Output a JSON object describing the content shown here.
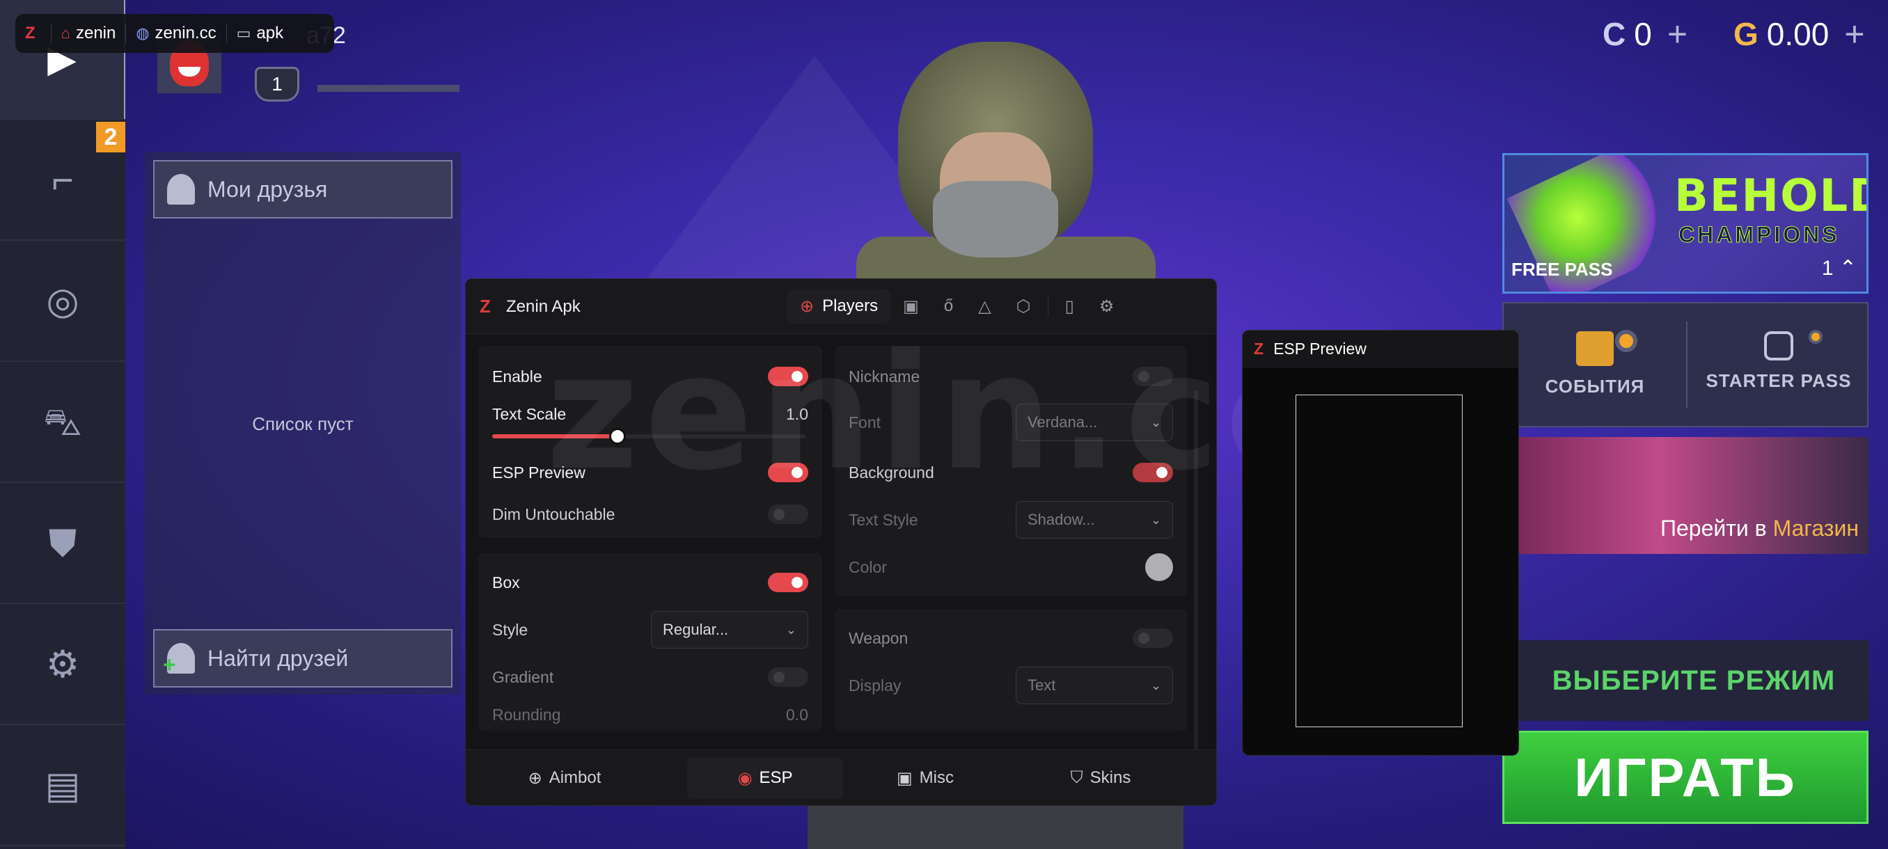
{
  "tagbar": {
    "logo": "Z",
    "tags": [
      {
        "icon": "tag-icon",
        "text": "zenin"
      },
      {
        "icon": "globe-icon",
        "text": "zenin.cc"
      },
      {
        "icon": "monitor-icon",
        "text": "apk"
      }
    ]
  },
  "player": {
    "name_fragment": "a72",
    "level": "1"
  },
  "sidebar": {
    "badge": "2"
  },
  "friends": {
    "my_friends": "Мои друзья",
    "empty": "Список пуст",
    "find_friends": "Найти друзей"
  },
  "currency": {
    "coins": "0",
    "gold": "0.00"
  },
  "promo": {
    "line1": "BEHOLDER",
    "line2": "CHAMPIONS",
    "free_pass": "FREE PASS",
    "pass_level": "1"
  },
  "events": {
    "events_label": "СОБЫТИЯ",
    "starter_pass_label": "STARTER PASS"
  },
  "shop": {
    "prefix": "Перейти в",
    "store": "Магазин"
  },
  "mode_button": "ВЫБЕРИТЕ РЕЖИМ",
  "play_button": "ИГРАТЬ",
  "menu": {
    "logo": "Z",
    "title": "Zenin Apk",
    "active_tab": "Players",
    "watermark": "zenin.cc",
    "left": {
      "enable": "Enable",
      "text_scale": "Text Scale",
      "text_scale_value": "1.0",
      "text_scale_fraction": 0.4,
      "esp_preview": "ESP Preview",
      "dim_untouchable": "Dim Untouchable",
      "box": "Box",
      "style": "Style",
      "style_value": "Regular...",
      "gradient": "Gradient",
      "rounding": "Rounding",
      "rounding_value": "0.0"
    },
    "right": {
      "nickname": "Nickname",
      "font": "Font",
      "font_value": "Verdana...",
      "background": "Background",
      "text_style": "Text Style",
      "text_style_value": "Shadow...",
      "color": "Color",
      "weapon": "Weapon",
      "display": "Display",
      "display_value": "Text"
    },
    "footer": {
      "aimbot": "Aimbot",
      "esp": "ESP",
      "misc": "Misc",
      "skins": "Skins"
    }
  },
  "preview": {
    "logo": "Z",
    "title": "ESP Preview"
  },
  "colors": {
    "accent": "#e5484d",
    "play_green": "#2fb83a",
    "mode_green": "#5bd46a",
    "badge_orange": "#f29a26"
  }
}
